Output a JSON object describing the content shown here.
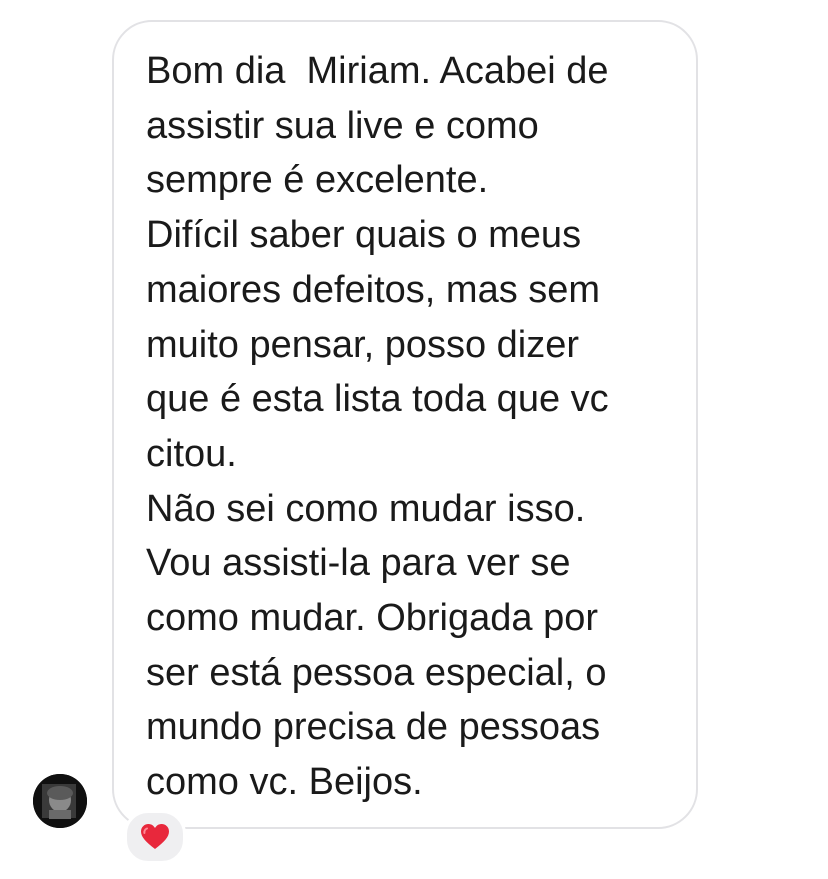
{
  "message": {
    "lines": [
      "Bom dia  Miriam. Acabei de",
      "assistir sua live e como",
      "sempre é excelente.",
      "Difícil saber quais o meus",
      "maiores defeitos, mas sem",
      "muito pensar, posso dizer",
      "que é esta lista toda que vc",
      "citou.",
      "Não sei como mudar isso.",
      "Vou assisti-la para ver se",
      "como mudar. Obrigada por",
      "ser está pessoa especial, o",
      "mundo precisa de pessoas",
      "como vc. Beijos."
    ]
  },
  "reaction": {
    "icon": "red-heart-icon",
    "color": "#e8283c"
  },
  "sender": {
    "avatar_icon": "sender-avatar"
  },
  "colors": {
    "bubble_border": "#e2e2e5",
    "text": "#1a1a1a",
    "reaction_background": "#efeff1"
  }
}
